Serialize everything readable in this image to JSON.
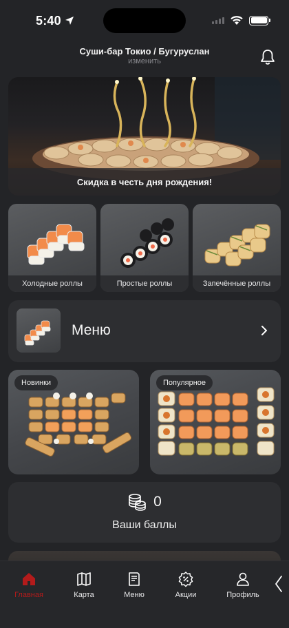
{
  "status_bar": {
    "time": "5:40"
  },
  "header": {
    "title": "Суши-бар Токио / Бугуруслан",
    "subtitle": "изменить"
  },
  "banner": {
    "caption": "Скидка в честь дня рождения!"
  },
  "categories": [
    {
      "label": "Холодные роллы"
    },
    {
      "label": "Простые роллы"
    },
    {
      "label": "Запечённые роллы"
    }
  ],
  "menu": {
    "label": "Меню"
  },
  "collections": [
    {
      "badge": "Новинки"
    },
    {
      "badge": "Популярное"
    }
  ],
  "points": {
    "value": "0",
    "label": "Ваши баллы"
  },
  "tabs": [
    {
      "label": "Главная",
      "active": true
    },
    {
      "label": "Карта"
    },
    {
      "label": "Меню"
    },
    {
      "label": "Акции"
    },
    {
      "label": "Профиль"
    }
  ],
  "colors": {
    "accent": "#b31b1b",
    "background": "#232427",
    "card": "#2d2e31"
  }
}
